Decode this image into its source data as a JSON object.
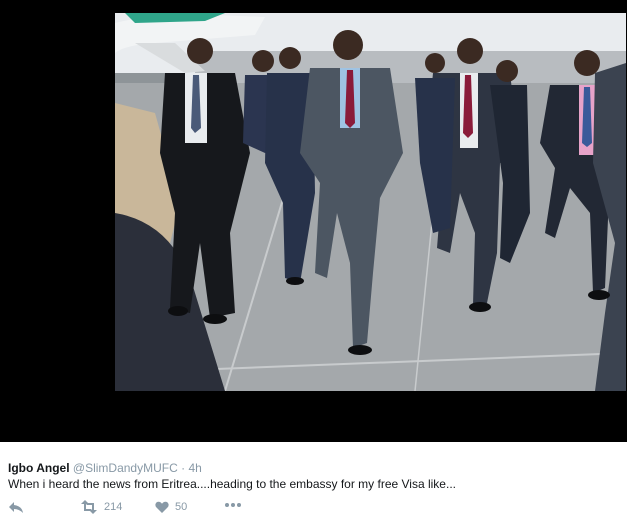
{
  "tweet": {
    "author_name": "Igbo Angel",
    "author_handle": "@SlimDandyMUFC",
    "separator": "·",
    "timestamp": "4h",
    "text": "When i heard the news from Eritrea....heading to the embassy for my free Visa like..."
  },
  "media": {
    "description_icon": "photo",
    "frame_color": "#000000"
  },
  "actions": {
    "reply_icon": "reply-icon",
    "retweet_icon": "retweet-icon",
    "retweet_count": "214",
    "like_icon": "heart-icon",
    "like_count": "50",
    "more_icon": "more-dots-icon"
  },
  "colors": {
    "name": "#14171a",
    "meta": "#8899a6",
    "background": "#ffffff"
  }
}
